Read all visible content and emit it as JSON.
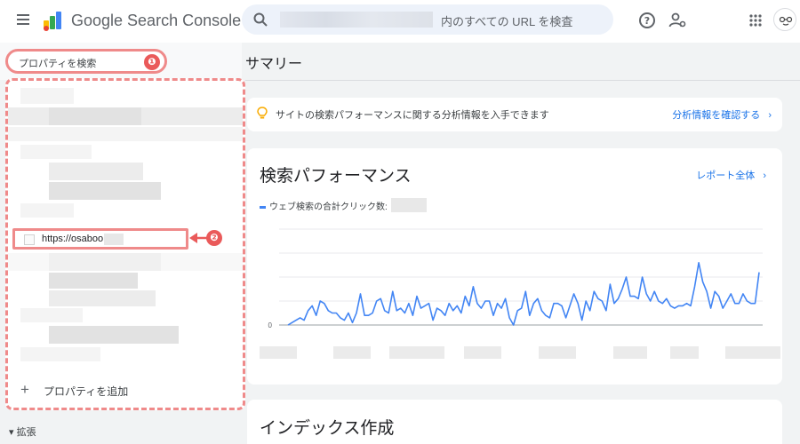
{
  "header": {
    "brand": "Google Search Console",
    "search_placeholder": "内のすべての URL を検査",
    "icons": [
      "menu-icon",
      "help-icon",
      "manage-users-icon",
      "apps-icon",
      "avatar"
    ]
  },
  "sidebar": {
    "property_search_label": "プロパティを検索",
    "property_url": "https://osaboo",
    "add_property_label": "プロパティを追加",
    "expand_label": "拡張",
    "badge_1": "❶",
    "badge_2": "❷"
  },
  "main": {
    "page_title": "サマリー",
    "insight_text": "サイトの検索パフォーマンスに関する分析情報を入手できます",
    "insight_link": "分析情報を確認する",
    "performance": {
      "title": "検索パフォーマンス",
      "report_link": "レポート全体",
      "legend": "ウェブ検索の合計クリック数:"
    },
    "index_title": "インデックス作成"
  },
  "colors": {
    "accent": "#1a73e8",
    "series": "#4285f4",
    "annotation": "#ef8a8a",
    "badge": "#ea5a5a"
  },
  "chart_data": {
    "type": "line",
    "title": "",
    "xlabel": "",
    "ylabel": "",
    "y_tick_labels": [
      "0"
    ],
    "ylim": [
      0,
      4
    ],
    "grid": true,
    "series": [
      {
        "values": [
          0.0,
          0.1,
          0.2,
          0.3,
          0.2,
          0.6,
          0.8,
          0.4,
          1.0,
          0.9,
          0.6,
          0.5,
          0.5,
          0.3,
          0.2,
          0.5,
          0.1,
          0.5,
          1.3,
          0.4,
          0.4,
          0.5,
          1.0,
          1.1,
          0.6,
          0.5,
          1.4,
          0.6,
          0.7,
          0.5,
          0.9,
          0.4,
          1.2,
          0.7,
          0.8,
          0.9,
          0.2,
          0.7,
          0.6,
          0.4,
          0.9,
          0.6,
          0.8,
          0.5,
          1.2,
          0.8,
          1.6,
          0.9,
          0.7,
          1.0,
          1.0,
          0.4,
          0.9,
          0.7,
          1.1,
          0.3,
          0.0,
          0.6,
          0.7,
          1.4,
          0.4,
          0.9,
          1.1,
          0.6,
          0.4,
          0.3,
          0.9,
          0.9,
          0.8,
          0.3,
          0.8,
          1.3,
          0.9,
          0.2,
          1.0,
          0.6,
          1.4,
          1.1,
          1.0,
          0.6,
          1.7,
          0.9,
          1.1,
          1.5,
          2.0,
          1.2,
          1.2,
          1.1,
          2.0,
          1.3,
          1.0,
          1.4,
          1.0,
          0.9,
          1.1,
          0.8,
          0.7,
          0.8,
          0.8,
          0.9,
          0.8,
          1.6,
          2.6,
          1.8,
          1.4,
          0.7,
          1.4,
          1.2,
          0.7,
          1.0,
          1.3,
          0.9,
          0.9,
          1.3,
          1.0,
          0.9,
          0.9,
          2.2
        ]
      }
    ]
  }
}
